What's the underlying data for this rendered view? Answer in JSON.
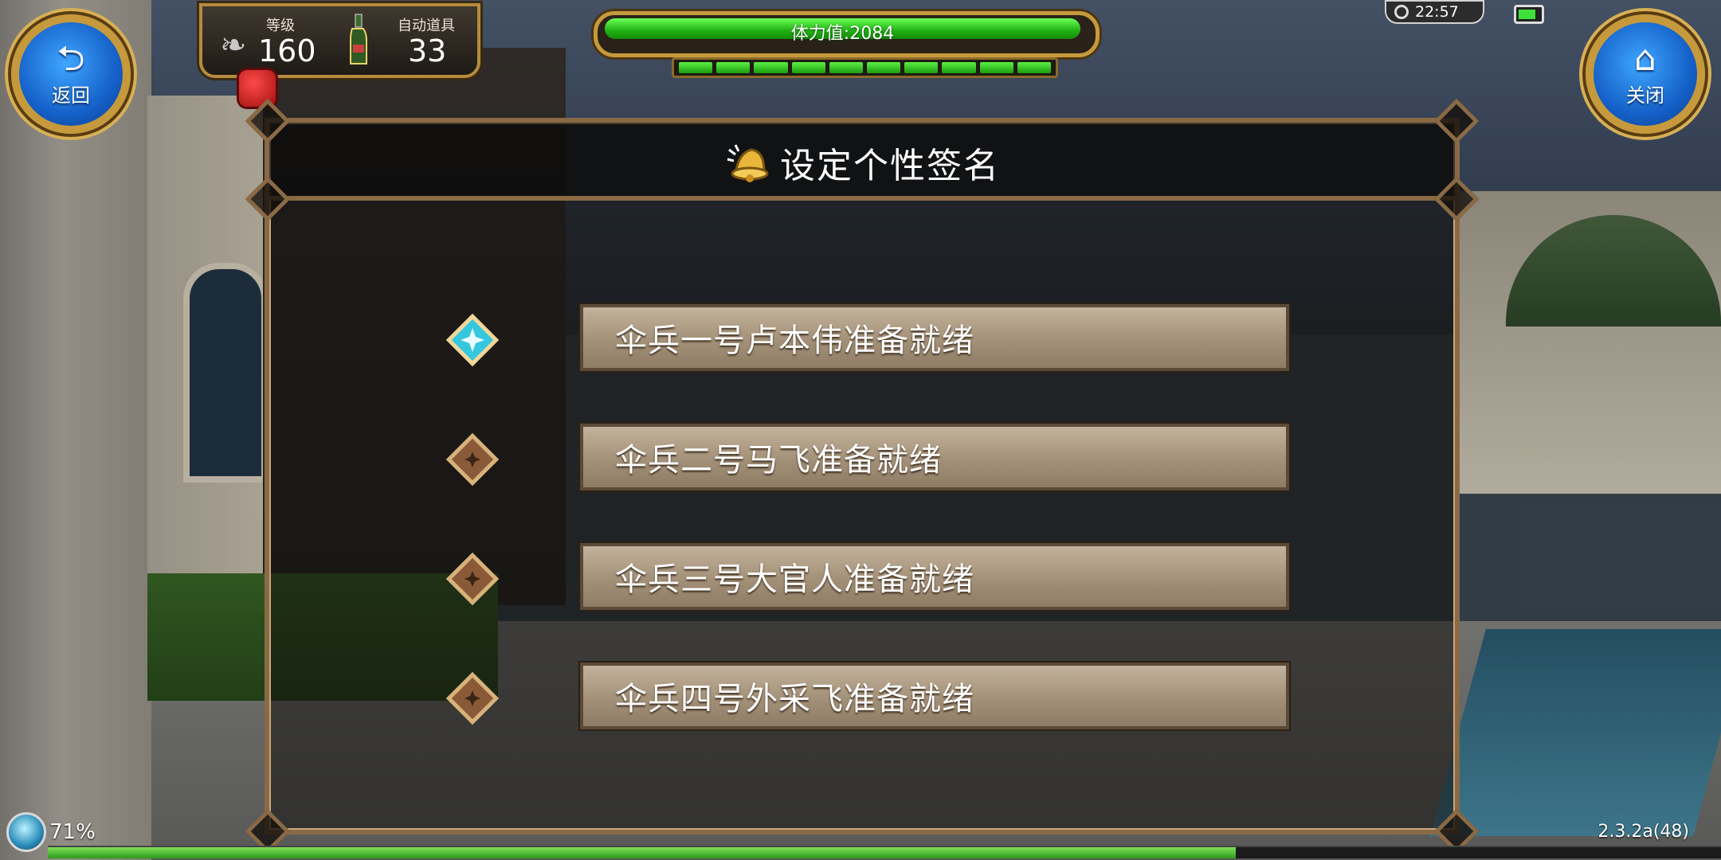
{
  "hud": {
    "back_label": "返回",
    "close_label": "关闭",
    "level_label": "等级",
    "level_value": "160",
    "auto_item_label": "自动道具",
    "auto_item_value": "33",
    "stamina_text": "体力值:2084",
    "stamina_segments": 10,
    "time": "22:57",
    "battery_level": 0.8
  },
  "dialog": {
    "title": "设定个性签名",
    "options": [
      {
        "label": "伞兵一号卢本伟准备就绪",
        "selected": true
      },
      {
        "label": "伞兵二号马飞准备就绪",
        "selected": false
      },
      {
        "label": "伞兵三号大官人准备就绪",
        "selected": false
      },
      {
        "label": "伞兵四号外采飞准备就绪",
        "selected": false
      }
    ]
  },
  "footer": {
    "xp_percent": "71%",
    "xp_fraction": 0.71,
    "version": "2.3.2a(48)"
  },
  "icons": {
    "back": "back-arrow-icon",
    "close": "home-icon",
    "bell": "bell-icon",
    "gem_selected": "selected-gem-icon",
    "gem_unselected": "unselected-gem-icon"
  },
  "colors": {
    "accent_gold": "#c69a3c",
    "stamina_green": "#1fb212",
    "panel_border": "#8a6a45",
    "gem_selected": "#35c7e0",
    "gem_unselected": "#8a5a38"
  }
}
